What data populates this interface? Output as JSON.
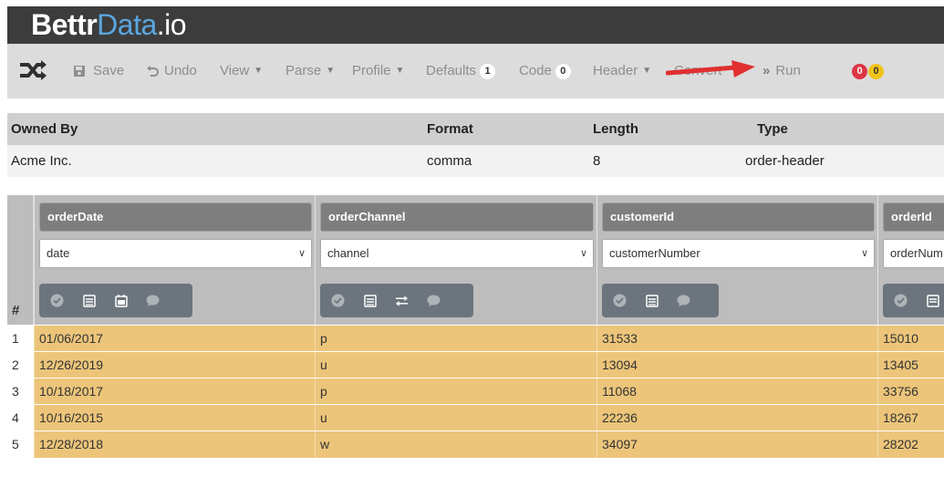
{
  "brand": {
    "part1": "Bettr",
    "part2": "Data",
    "part3": ".io"
  },
  "toolbar": {
    "save": "Save",
    "undo": "Undo",
    "view": "View",
    "parse": "Parse",
    "profile": "Profile",
    "defaults": "Defaults",
    "defaults_count": "1",
    "code": "Code",
    "code_count": "0",
    "header": "Header",
    "convert": "Convert",
    "run": "Run",
    "error_count": "0",
    "warning_count": "0"
  },
  "info": {
    "headers": {
      "owned_by": "Owned By",
      "format": "Format",
      "length": "Length",
      "type": "Type"
    },
    "values": {
      "owned_by": "Acme Inc.",
      "format": "comma",
      "length": "8",
      "type": "order-header"
    }
  },
  "grid": {
    "row_number_header": "#",
    "columns": [
      {
        "name": "orderDate",
        "type": "date"
      },
      {
        "name": "orderChannel",
        "type": "channel"
      },
      {
        "name": "customerId",
        "type": "customerNumber"
      },
      {
        "name": "orderId",
        "type": "orderNum"
      }
    ],
    "rows": [
      {
        "n": "1",
        "cells": [
          "01/06/2017",
          "p",
          "31533",
          "15010"
        ]
      },
      {
        "n": "2",
        "cells": [
          "12/26/2019",
          "u",
          "13094",
          "13405"
        ]
      },
      {
        "n": "3",
        "cells": [
          "10/18/2017",
          "p",
          "11068",
          "33756"
        ]
      },
      {
        "n": "4",
        "cells": [
          "10/16/2015",
          "u",
          "22236",
          "18267"
        ]
      },
      {
        "n": "5",
        "cells": [
          "12/28/2018",
          "w",
          "34097",
          "28202"
        ]
      }
    ]
  },
  "colors": {
    "brand_bar": "#3c3c3c",
    "toolbar": "#dcdcdc",
    "cell_fill": "#ecc57a",
    "accent_blue": "#5aa6e0",
    "arrow": "#e03030"
  }
}
